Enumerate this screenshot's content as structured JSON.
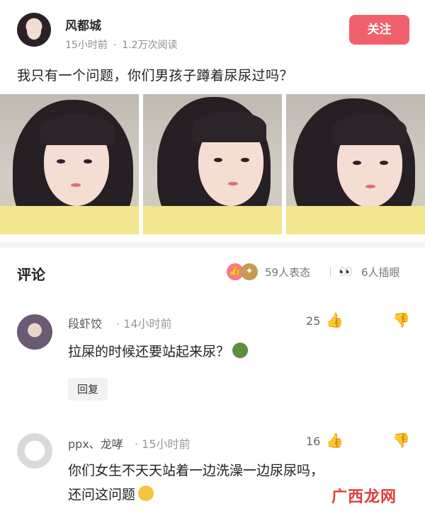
{
  "post": {
    "author_name": "风都城",
    "time": "15小时前",
    "separator": "·",
    "views": "1.2万次阅读",
    "follow_label": "关注",
    "question": "我只有一个问题，你们男孩子蹲着尿尿过吗？",
    "images": [
      "portrait-photo-1",
      "portrait-photo-2",
      "portrait-photo-3"
    ]
  },
  "comments_header": {
    "title": "评论",
    "reactions_count": "59人表态",
    "separator": "|",
    "eyes_count": "6人插眼"
  },
  "comments": [
    {
      "name": "段虾饺",
      "time": "· 14小时前",
      "likes": "25",
      "text": "拉屎的时候还要站起来尿？",
      "reply_label": "回复"
    },
    {
      "name": "ppx、龙哮",
      "time": "· 15小时前",
      "likes": "16",
      "text_line1": "你们女生不天天站着一边洗澡一边尿尿吗，",
      "text_line2": "还问这问题"
    }
  ],
  "watermark": "广西龙网",
  "colors": {
    "accent": "#f0616d",
    "watermark": "#e23c3c"
  }
}
